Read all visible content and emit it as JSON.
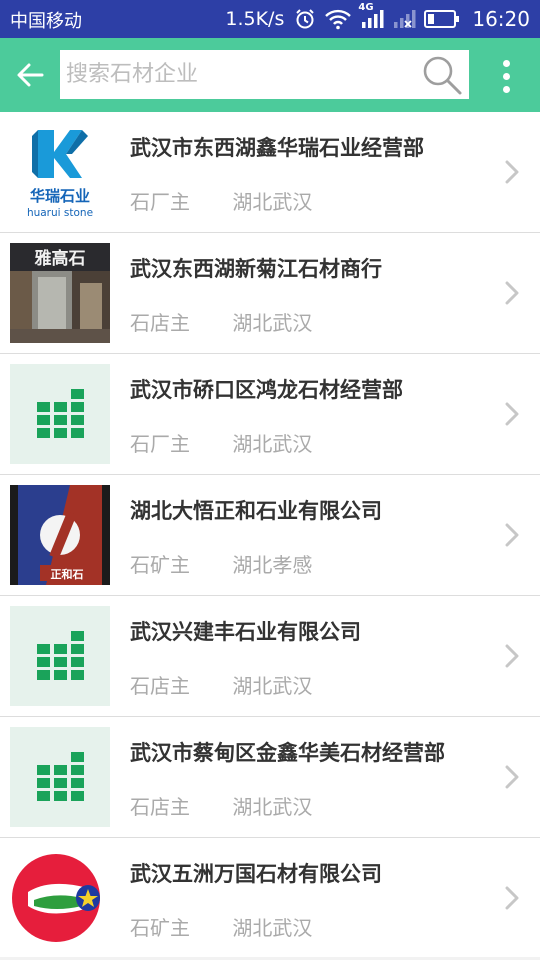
{
  "status_bar": {
    "carrier": "中国移动",
    "net_speed": "1.5K/s",
    "network_type": "4G",
    "time": "16:20"
  },
  "app_bar": {
    "search_placeholder": "搜索石材企业"
  },
  "colors": {
    "status_bar_bg": "#2d3fa6",
    "app_bar_bg": "#4ccb9b",
    "generic_logo_bg": "#e6f2ec",
    "generic_logo_fg": "#1aa35a"
  },
  "companies": [
    {
      "name": "武汉市东西湖鑫华瑞石业经营部",
      "role": "石厂主",
      "location": "湖北武汉",
      "logo": "huarui-stone-logo",
      "logo_text": "华瑞石业",
      "logo_subtext": "huarui stone"
    },
    {
      "name": "武汉东西湖新菊江石材商行",
      "role": "石店主",
      "location": "湖北武汉",
      "logo": "storefront-photo",
      "logo_text": "雅高石"
    },
    {
      "name": "武汉市硚口区鸿龙石材经营部",
      "role": "石厂主",
      "location": "湖北武汉",
      "logo": "default-stone-logo"
    },
    {
      "name": "湖北大悟正和石业有限公司",
      "role": "石矿主",
      "location": "湖北孝感",
      "logo": "zhenghe-logo",
      "logo_text": "正和石"
    },
    {
      "name": "武汉兴建丰石业有限公司",
      "role": "石店主",
      "location": "湖北武汉",
      "logo": "default-stone-logo"
    },
    {
      "name": "武汉市蔡甸区金鑫华美石材经营部",
      "role": "石店主",
      "location": "湖北武汉",
      "logo": "default-stone-logo"
    },
    {
      "name": "武汉五洲万国石材有限公司",
      "role": "石矿主",
      "location": "湖北武汉",
      "logo": "wuzhou-wanguo-logo"
    }
  ]
}
